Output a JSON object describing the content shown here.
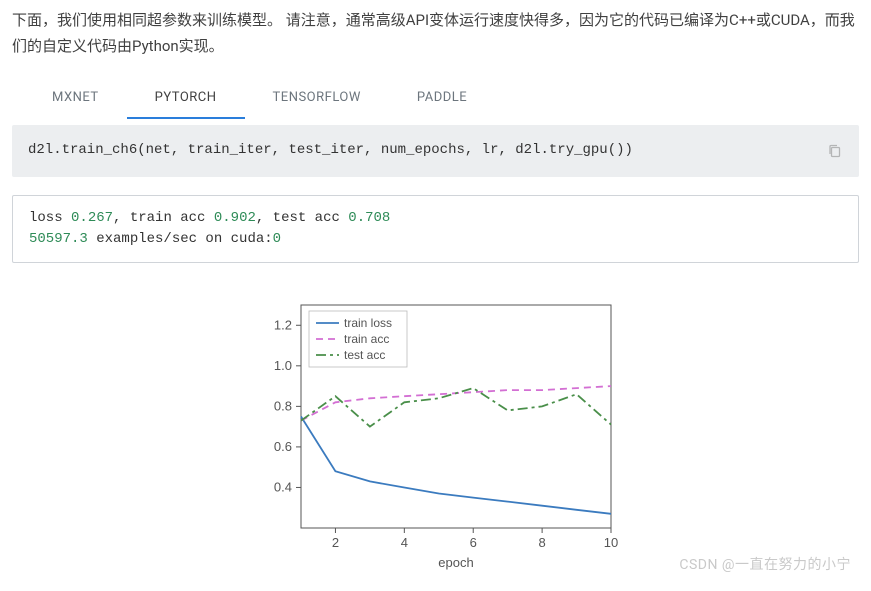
{
  "intro": "下面，我们使用相同超参数来训练模型。 请注意，通常高级API变体运行速度快得多，因为它的代码已编译为C++或CUDA，而我们的自定义代码由Python实现。",
  "tabs": {
    "items": [
      "MXNET",
      "PYTORCH",
      "TENSORFLOW",
      "PADDLE"
    ],
    "activeIndex": 1
  },
  "code": "d2l.train_ch6(net, train_iter, test_iter, num_epochs, lr, d2l.try_gpu())",
  "output": {
    "loss_label": "loss ",
    "loss_val": "0.267",
    "train_acc_label": ", train acc ",
    "train_acc_val": "0.902",
    "test_acc_label": ", test acc ",
    "test_acc_val": "0.708",
    "rate_val": "50597.3",
    "rate_text": " examples/sec on cuda:",
    "rate_dev": "0"
  },
  "watermark": "CSDN @一直在努力的小宁",
  "chart_data": {
    "type": "line",
    "xlabel": "epoch",
    "ylabel": "",
    "xlim": [
      1,
      10
    ],
    "ylim": [
      0.2,
      1.3
    ],
    "xticks": [
      2,
      4,
      6,
      8,
      10
    ],
    "yticks": [
      0.4,
      0.6,
      0.8,
      1.0,
      1.2
    ],
    "legend": [
      "train loss",
      "train acc",
      "test acc"
    ],
    "legend_pos": "upper-left",
    "x": [
      1,
      2,
      3,
      4,
      5,
      6,
      7,
      8,
      9,
      10
    ],
    "series": [
      {
        "name": "train loss",
        "color": "#3b7bbf",
        "style": "solid",
        "values": [
          0.75,
          0.48,
          0.43,
          0.4,
          0.37,
          0.35,
          0.33,
          0.31,
          0.29,
          0.27
        ]
      },
      {
        "name": "train acc",
        "color": "#d36fd3",
        "style": "dashed",
        "values": [
          0.73,
          0.82,
          0.84,
          0.85,
          0.86,
          0.87,
          0.88,
          0.88,
          0.89,
          0.9
        ]
      },
      {
        "name": "test acc",
        "color": "#4a8f4a",
        "style": "dashdot",
        "values": [
          0.73,
          0.85,
          0.7,
          0.82,
          0.84,
          0.89,
          0.78,
          0.8,
          0.86,
          0.71
        ]
      }
    ]
  }
}
